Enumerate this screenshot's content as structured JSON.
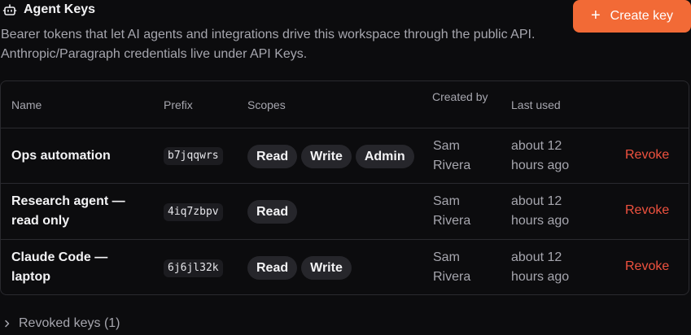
{
  "header": {
    "title": "Agent Keys",
    "icon": "robot-icon",
    "subtitle": "Bearer tokens that let AI agents and integrations drive this workspace through the public API. Anthropic/Paragraph credentials live under API Keys.",
    "create_button_label": "Create key",
    "create_button_icon": "plus-icon",
    "accent_color": "#f26a36"
  },
  "table": {
    "columns": {
      "name": "Name",
      "prefix": "Prefix",
      "scopes": "Scopes",
      "created_by": "Created by",
      "last_used": "Last used"
    },
    "rows": [
      {
        "name": "Ops automation",
        "prefix": "b7jqqwrs",
        "scopes": [
          "Read",
          "Write",
          "Admin"
        ],
        "created_by": "Sam Rivera",
        "last_used": "about 12 hours ago",
        "action": "Revoke"
      },
      {
        "name": "Research agent — read only",
        "prefix": "4iq7zbpv",
        "scopes": [
          "Read"
        ],
        "created_by": "Sam Rivera",
        "last_used": "about 12 hours ago",
        "action": "Revoke"
      },
      {
        "name": "Claude Code — laptop",
        "prefix": "6j6jl32k",
        "scopes": [
          "Read",
          "Write"
        ],
        "created_by": "Sam Rivera",
        "last_used": "about 12 hours ago",
        "action": "Revoke"
      }
    ]
  },
  "revoked_section": {
    "label": "Revoked keys (1)",
    "icon": "chevron-right-icon"
  }
}
